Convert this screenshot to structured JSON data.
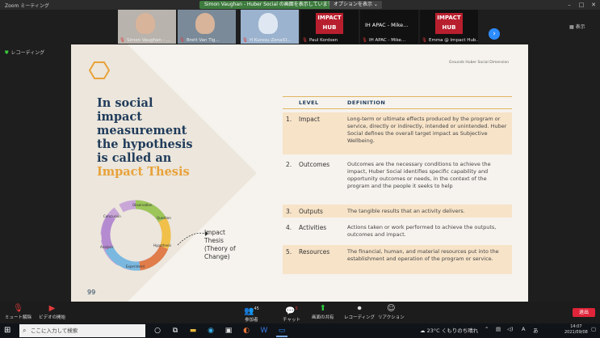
{
  "titlebar": {
    "app_title": "Zoom ミーティング",
    "banner": "Simon Vaughan - Huber Social の画面を表示しています",
    "view_options": "オプションを表示 ⌄"
  },
  "participants": [
    {
      "name": "Simon Vaughan - ...",
      "muted": true,
      "kind": "video"
    },
    {
      "name": "Brett Van Tig...",
      "muted": true,
      "kind": "video"
    },
    {
      "name": "H Kurosu-ZenaiO...",
      "muted": true,
      "kind": "video"
    },
    {
      "name": "Paul Kordsen",
      "muted": true,
      "kind": "hub"
    },
    {
      "name": "IH APAC - Mike...",
      "muted": true,
      "kind": "text",
      "tile_text": "IH APAC - Mike..."
    },
    {
      "name": "Emma @ Impact Hub...",
      "muted": true,
      "kind": "hub"
    }
  ],
  "hub_logo_text": "IMPACT HUB",
  "strip": {
    "next_icon": "›",
    "gallery_view": "表示"
  },
  "meeting_info": "レコーディング",
  "slide": {
    "brand": "Grounds Huber Social Dimension",
    "headline_parts": [
      "In social",
      "impact",
      "measurement",
      "the hypothesis",
      "is called an"
    ],
    "headline_highlight": "Impact Thesis",
    "cycle_labels": [
      "Observation",
      "Question",
      "Hypothesis",
      "Experiment",
      "Analysis",
      "Conclusion"
    ],
    "annotation_lines": [
      "Impact",
      "Thesis",
      "(Theory of",
      "Change)"
    ],
    "quote_mark": "99",
    "table": {
      "col_level": "LEVEL",
      "col_definition": "DEFINITION",
      "rows": [
        {
          "num": "1.",
          "level": "Impact",
          "definition": "Long-term or ultimate effects produced by the program or service, directly or indirectly, intended or unintended. Huber Social defines the overall target impact as Subjective Wellbeing."
        },
        {
          "num": "2.",
          "level": "Outcomes",
          "definition": "Outcomes are the necessary conditions to achieve the impact, Huber Social identifies specific capability and opportunity outcomes or needs, in the context of the program and the people it seeks to help"
        },
        {
          "num": "3.",
          "level": "Outputs",
          "definition": "The tangible results that an activity delivers."
        },
        {
          "num": "4.",
          "level": "Activities",
          "definition": "Actions taken or work performed to achieve the outputs, outcomes and impact."
        },
        {
          "num": "5.",
          "level": "Resources",
          "definition": "The financial, human, and material resources put into the establishment and operation of the program or service."
        }
      ]
    }
  },
  "toolbar": {
    "mute": "ミュート解除",
    "video": "ビデオの開始",
    "participants": "参加者",
    "participant_count": "45",
    "chat": "チャット",
    "chat_badge": "5",
    "share": "画面の共有",
    "record": "レコーディング",
    "reactions": "リアクション",
    "leave": "退出"
  },
  "taskbar": {
    "search_placeholder": "ここに入力して検索",
    "weather": "23°C  くもりのち晴れ",
    "ime": "A",
    "time": "14:07",
    "date": "2021/09/08"
  }
}
